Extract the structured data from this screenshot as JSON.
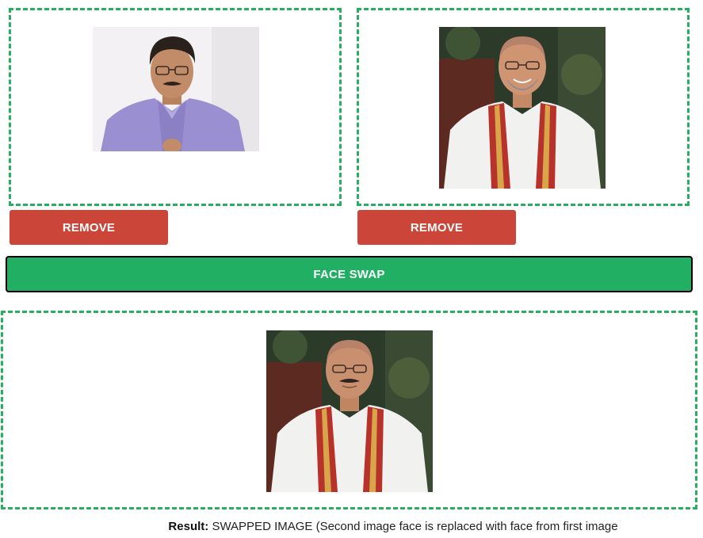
{
  "first_image": {
    "alt": "Man with glasses and mustache in purple shirt",
    "remove_label": "REMOVE"
  },
  "second_image": {
    "alt": "Smiling man in white kurta with red and gold stole",
    "remove_label": "REMOVE"
  },
  "swap_button_label": "FACE SWAP",
  "result_image": {
    "alt": "Swapped face image"
  },
  "result": {
    "label": "Result:",
    "text": "SWAPPED IMAGE (Second image face is replaced with face from first image"
  },
  "colors": {
    "dashed_border": "#27ae60",
    "remove_button": "#cc4539",
    "swap_button": "#21b063"
  }
}
